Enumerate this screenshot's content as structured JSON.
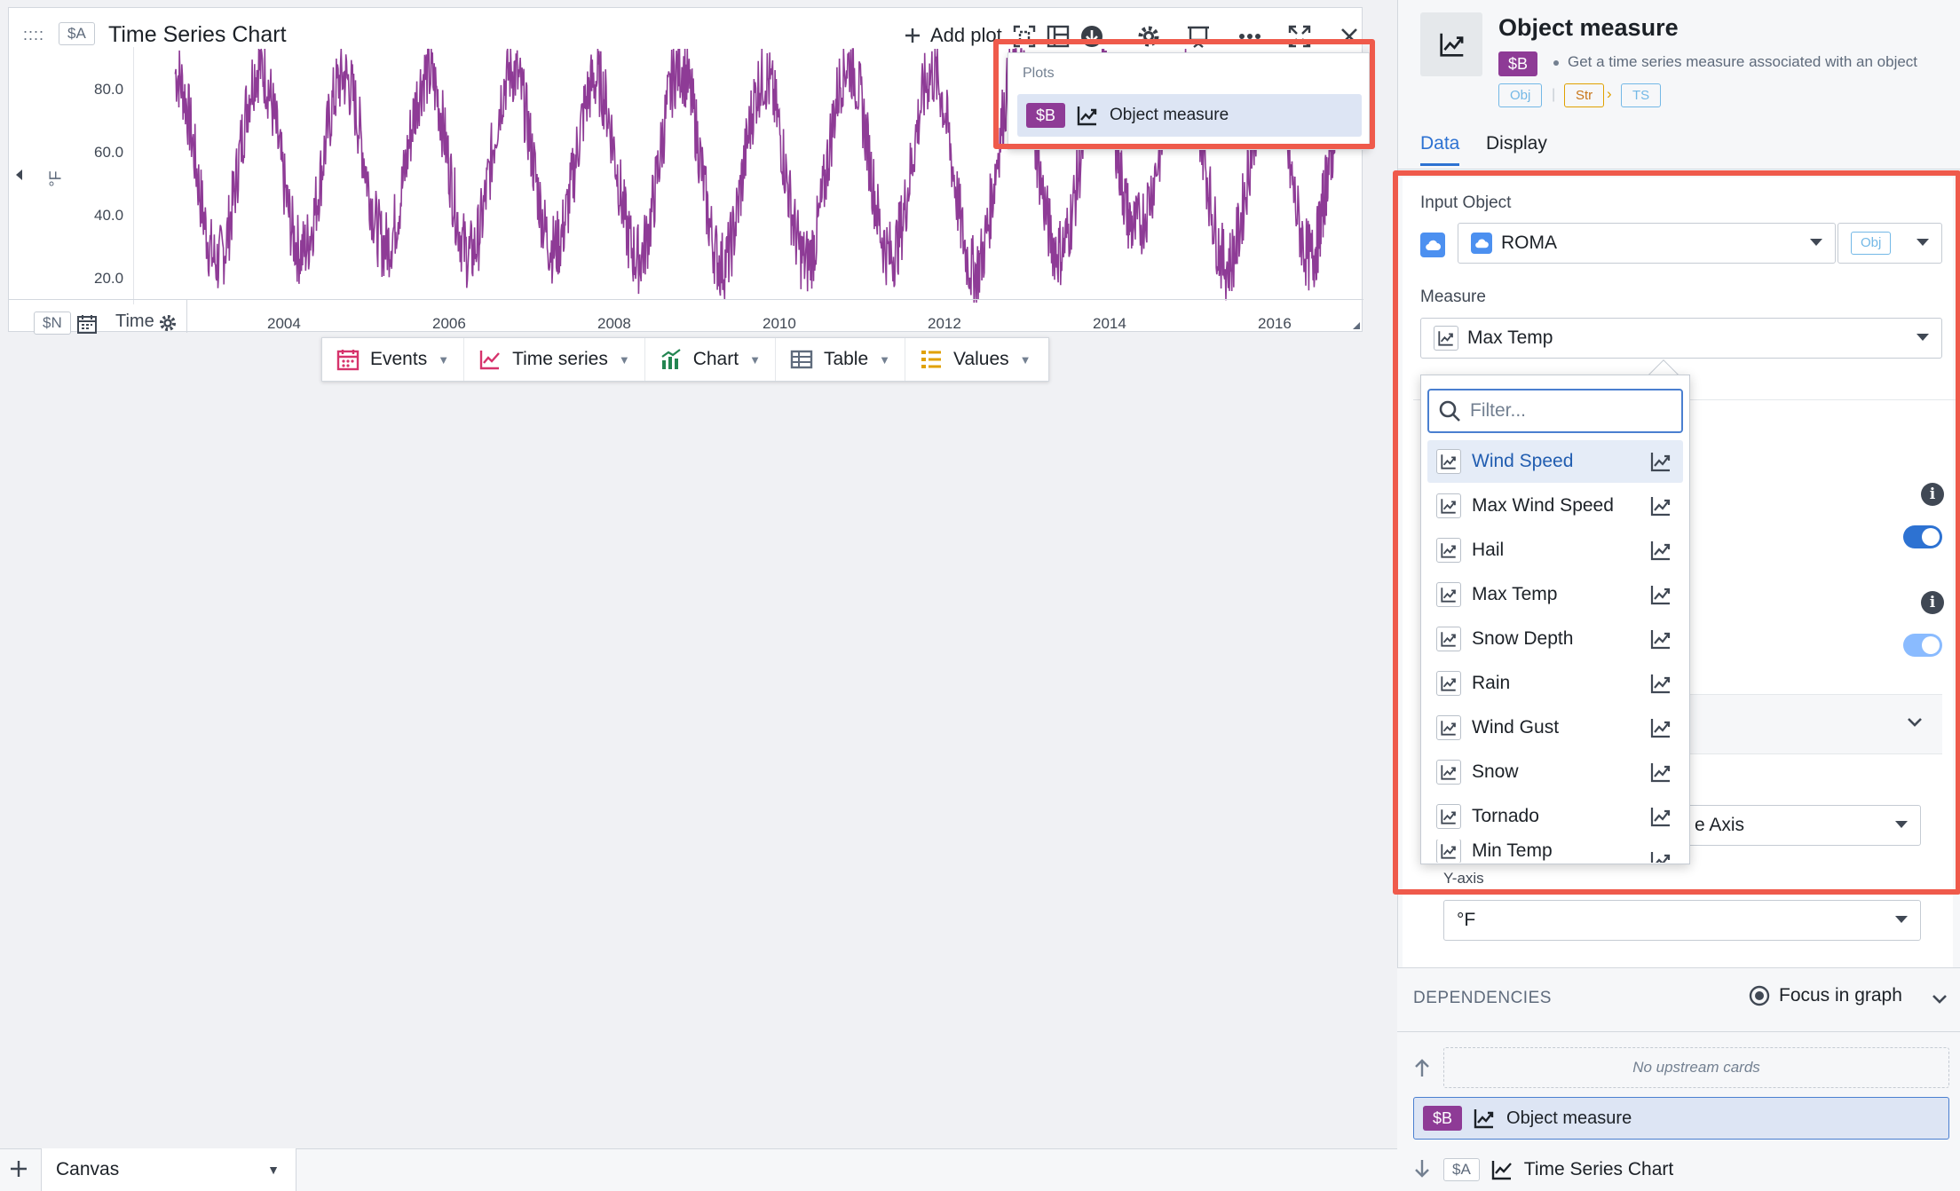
{
  "card": {
    "tag": "$A",
    "title": "Time Series Chart",
    "add_plot_label": "Add plot",
    "y_unit": "°F",
    "y_ticks": [
      "80.0",
      "60.0",
      "40.0",
      "20.0"
    ],
    "x_ticks": [
      "2004",
      "2006",
      "2008",
      "2010",
      "2012",
      "2014",
      "2016"
    ],
    "time_tag": "$N",
    "time_label": "Time",
    "series_color": "#8e3b96"
  },
  "chart_data": {
    "type": "line",
    "xlabel": "Time",
    "ylabel": "°F",
    "ylim": [
      12,
      90
    ],
    "x_range": [
      2002.0,
      2016.6
    ],
    "series": [
      {
        "name": "Object measure",
        "description": "Seasonal daily max temperature oscillating roughly between 20 and 85 °F from about 2002 to 2016",
        "x": [
          2002.5,
          2003.0,
          2003.5,
          2004.0,
          2004.5,
          2005.0,
          2005.5,
          2006.0,
          2006.5,
          2007.0,
          2007.5,
          2008.0,
          2008.5,
          2009.0,
          2009.5,
          2010.0,
          2010.5,
          2011.0,
          2011.5,
          2012.0,
          2012.5,
          2013.0,
          2013.5,
          2013.9,
          2014.5,
          2015.0,
          2015.5,
          2016.0,
          2016.3
        ],
        "y": [
          82,
          25,
          84,
          28,
          81,
          30,
          82,
          27,
          83,
          29,
          80,
          26,
          84,
          24,
          81,
          25,
          85,
          27,
          82,
          22,
          84,
          28,
          81,
          35,
          82,
          24,
          80,
          26,
          62
        ]
      }
    ]
  },
  "plots_popover": {
    "label": "Plots",
    "item_tag": "$B",
    "item_label": "Object measure"
  },
  "add_bar": [
    {
      "label": "Events",
      "color": "#cd4246"
    },
    {
      "label": "Time series",
      "color": "#cd4246"
    },
    {
      "label": "Chart",
      "color": "#238551"
    },
    {
      "label": "Table",
      "color": "#5f6b7c"
    },
    {
      "label": "Values",
      "color": "#c87619"
    }
  ],
  "bottom_tab": {
    "label": "Canvas"
  },
  "panel": {
    "title": "Object measure",
    "tag": "$B",
    "description": "Get a time series measure associated with an object",
    "types": [
      "Obj",
      "Str",
      "TS"
    ],
    "tabs": [
      "Data",
      "Display"
    ],
    "input_object_label": "Input Object",
    "input_object_value": "ROMA",
    "input_object_type": "Obj",
    "measure_label": "Measure",
    "measure_value": "Max Temp",
    "hidden_axis_value": "e Axis",
    "y_axis_label": "Y-axis",
    "y_axis_value": "°F"
  },
  "measure_menu": {
    "placeholder": "Filter...",
    "items": [
      "Wind Speed",
      "Max Wind Speed",
      "Hail",
      "Max Temp",
      "Snow Depth",
      "Rain",
      "Wind Gust",
      "Snow",
      "Tornado",
      "Min Temp"
    ],
    "active_index": 0
  },
  "dependencies": {
    "title": "DEPENDENCIES",
    "focus_label": "Focus in graph",
    "upstream_empty": "No upstream cards",
    "current_tag": "$B",
    "current_label": "Object measure",
    "downstream_tag": "$A",
    "downstream_label": "Time Series Chart"
  }
}
